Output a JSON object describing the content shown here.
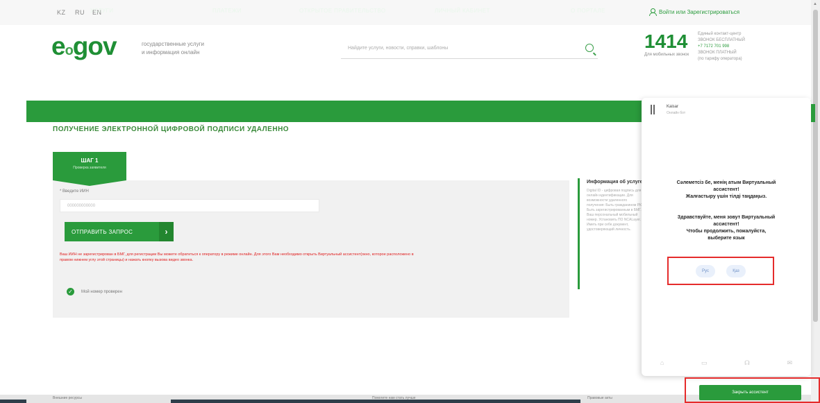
{
  "topbar": {
    "languages": [
      "KZ",
      "RU",
      "EN"
    ],
    "login_text": "Войти или Зарегистрироваться"
  },
  "logo": {
    "prefix": "e",
    "small": "ο",
    "main": "gov",
    "tagline_1": "государственные услуги",
    "tagline_2": "и информация онлайн"
  },
  "search": {
    "placeholder": "Найдите услуги, новости, справки, шаблоны"
  },
  "contact": {
    "number": "1414",
    "number_caption": "Для мобильных звонок",
    "lines": [
      "Единый контакт-центр",
      "ЗВОНОК БЕСПЛАТНЫЙ",
      "+7 7172 701 998",
      "ЗВОНОК ПЛАТНЫЙ",
      "(по тарифу оператора)"
    ]
  },
  "nav": {
    "items": [
      "УСЛУГИ",
      "ПЛАТЕЖИ",
      "ОТКРЫТОЕ ПРАВИТЕЛЬСТВО",
      "ЛИЧНЫЙ КАБИНЕТ",
      "О ПОРТАЛЕ"
    ]
  },
  "main": {
    "page_title": "ПОЛУЧЕНИЕ ЭЛЕКТРОННОЙ ЦИФРОВОЙ ПОДПИСИ УДАЛЕННО",
    "step": {
      "title": "ШАГ 1",
      "subtitle": "Проверка заявителя"
    },
    "iin_label": "* Введите ИИН",
    "iin_value": "000000000000",
    "send_button": "ОТПРАВИТЬ ЗАПРОС",
    "chevron": "›",
    "warning": "Ваш ИИН не зарегистрирован в БМГ, для регистрации Вы можете обратиться к оператору в режиме онлайн. Для этого Вам необходимо открыть Виртуальный ассистент(окно, которое расположено в правом нижнем углу этой страницы) и нажать кнопку вызова видео звонка.",
    "check_label": "Мой номер проверен",
    "check_mark": "✓"
  },
  "info_panel": {
    "title": "Информация об услуге",
    "text": "Digital ID - цифровая подпись для онлайн идентификации. Для возможности удаленного получения: Быть гражданином РК. Быть зарегистрированным в БМГ. Ваш персональный мобильный номер. Установить ПО NCALayer. Иметь при себе документ, удостоверяющий личность."
  },
  "chat": {
    "bot_name": "Kaisar",
    "bot_status": "Онлайн бот",
    "message_kz_1": "Сәлеметсіз бе, менің атым Виртуальный",
    "message_kz_2": "ассистент!",
    "message_kz_3": "Жалғастыру үшін тілді таңдаңыз.",
    "message_ru_1": "Здравствуйте, меня зовут Виртуальный",
    "message_ru_2": "ассистент!",
    "message_ru_3": "Чтобы продолжить, пожалуйста,",
    "message_ru_4": "выберите язык",
    "lang_ru": "Рус",
    "lang_kz": "Қаз",
    "footer_icons": [
      "⌂",
      "▭",
      "☊",
      "✉"
    ]
  },
  "assistant_button": "Закрыть ассистент",
  "footer": {
    "left": "Внешние ресурсы",
    "center": "Помогите нам стать лучше",
    "right": "Правовые акты"
  },
  "colors": {
    "brand_green": "#2a9b3c",
    "highlight_red": "#e52b2b"
  }
}
